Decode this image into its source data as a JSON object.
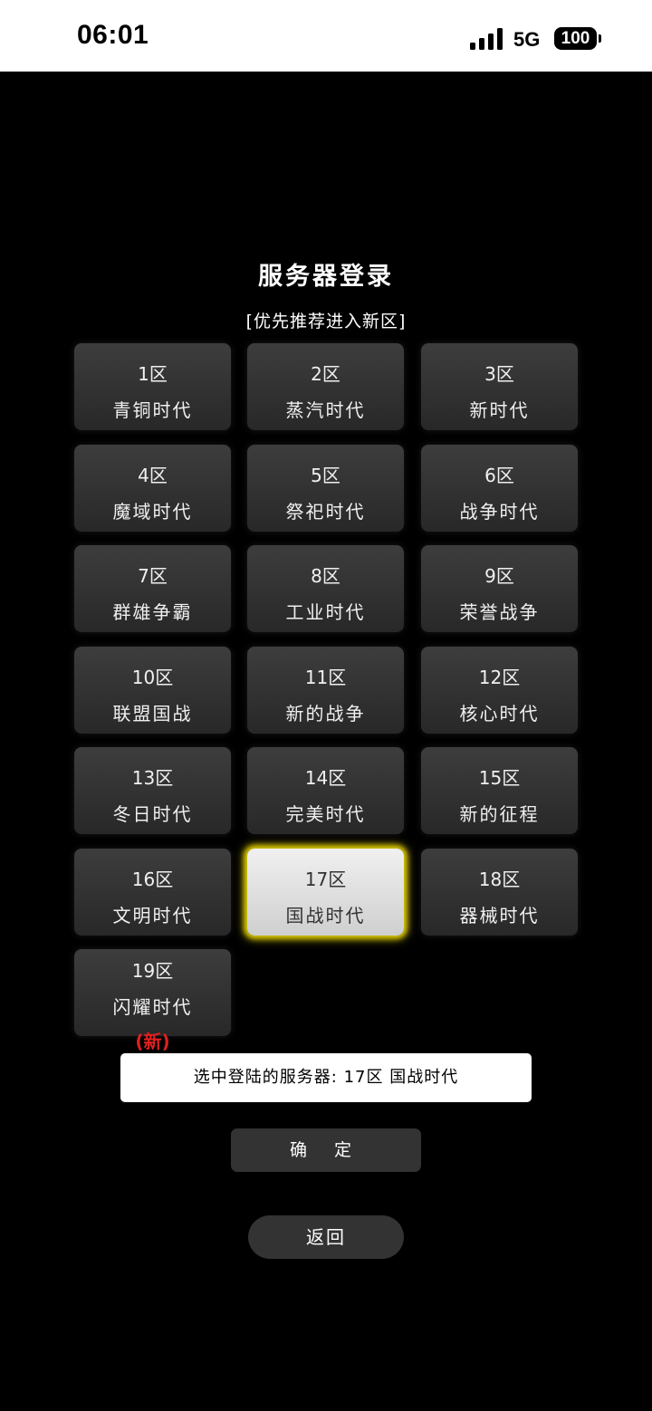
{
  "status_bar": {
    "time": "06:01",
    "network": "5G",
    "battery": "100",
    "signal_icon": "cellular-signal-icon",
    "battery_icon": "battery-icon"
  },
  "header": {
    "title": "服务器登录",
    "subtitle": "[优先推荐进入新区]"
  },
  "servers": [
    {
      "zone": "1区",
      "name": "青铜时代"
    },
    {
      "zone": "2区",
      "name": "蒸汽时代"
    },
    {
      "zone": "3区",
      "name": "新时代"
    },
    {
      "zone": "4区",
      "name": "魔域时代"
    },
    {
      "zone": "5区",
      "name": "祭祀时代"
    },
    {
      "zone": "6区",
      "name": "战争时代"
    },
    {
      "zone": "7区",
      "name": "群雄争霸"
    },
    {
      "zone": "8区",
      "name": "工业时代"
    },
    {
      "zone": "9区",
      "name": "荣誉战争"
    },
    {
      "zone": "10区",
      "name": "联盟国战"
    },
    {
      "zone": "11区",
      "name": "新的战争"
    },
    {
      "zone": "12区",
      "name": "核心时代"
    },
    {
      "zone": "13区",
      "name": "冬日时代"
    },
    {
      "zone": "14区",
      "name": "完美时代"
    },
    {
      "zone": "15区",
      "name": "新的征程"
    },
    {
      "zone": "16区",
      "name": "文明时代"
    },
    {
      "zone": "17区",
      "name": "国战时代",
      "selected": true
    },
    {
      "zone": "18区",
      "name": "器械时代"
    },
    {
      "zone": "19区",
      "name": "闪耀时代",
      "badge": "(新)"
    }
  ],
  "selection": {
    "label": "选中登陆的服务器:",
    "value": "17区 国战时代"
  },
  "buttons": {
    "confirm": "确 定",
    "back": "返回"
  },
  "colors": {
    "background": "#000000",
    "tile": "#333333",
    "selected_glow": "#d9c800",
    "new_badge": "#e02020"
  }
}
